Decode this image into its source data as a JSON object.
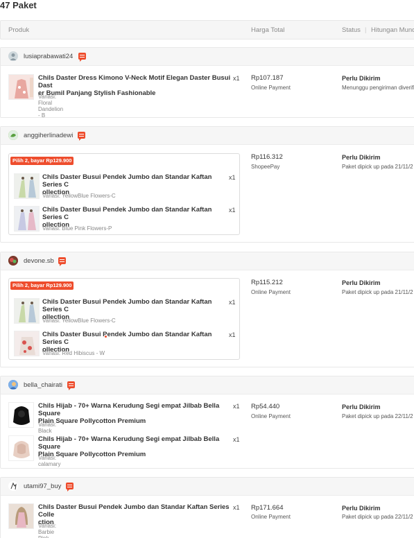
{
  "page_title": "47 Paket",
  "table_header": {
    "produk": "Produk",
    "harga_total": "Harga Total",
    "status": "Status",
    "separator": "|",
    "hitungan": "Hitungan Mundur"
  },
  "orders": [
    {
      "username": "lusiaprabawati24",
      "items": [
        {
          "name_line1": "Chils Daster Dress Kimono V-Neck Motif Elegan Daster Busui Dast",
          "name_line2": "er Bumil Panjang Stylish Fashionable",
          "qty": "x1",
          "variant": "Variasi: Floral Dandelion - B"
        }
      ],
      "price": "Rp107.187",
      "payment": "Online Payment",
      "status": "Perlu Dikirim",
      "status_desc": "Menunggu pengiriman diverifi"
    },
    {
      "username": "anggiherlinadewi",
      "promo": "Pilih 2, bayar Rp129.900",
      "items": [
        {
          "name_line1": "Chils Daster Busui Pendek Jumbo dan Standar Kaftan Series C",
          "name_line2": "ollection",
          "qty": "x1",
          "variant": "Variasi: YellowBlue Flowers-C"
        },
        {
          "name_line1": "Chils Daster Busui Pendek Jumbo dan Standar Kaftan Series C",
          "name_line2": "ollection",
          "qty": "x1",
          "variant": "Variasi: Blue Pink Flowers-P"
        }
      ],
      "price": "Rp116.312",
      "payment": "ShopeePay",
      "status": "Perlu Dikirim",
      "status_desc": "Paket dipick up pada 21/11/2"
    },
    {
      "username": "devone.sb",
      "promo": "Pilih 2, bayar Rp129.900",
      "items": [
        {
          "name_line1": "Chils Daster Busui Pendek Jumbo dan Standar Kaftan Series C",
          "name_line2": "ollection",
          "qty": "x1",
          "variant": "Variasi: YellowBlue Flowers-C"
        },
        {
          "name_line1": "Chils Daster Busui Pendek Jumbo dan Standar Kaftan Series C",
          "name_line2": "ollection",
          "qty": "x1",
          "variant": "Variasi: Red Hibiscus - W"
        }
      ],
      "price": "Rp115.212",
      "payment": "Online Payment",
      "status": "Perlu Dikirim",
      "status_desc": "Paket dipick up pada 21/11/2"
    },
    {
      "username": "bella_chairati",
      "items": [
        {
          "name_line1": "Chils Hijab - 70+ Warna Kerudung Segi empat Jilbab Bella Square",
          "name_line2": "Plain Square Pollycotton Premium",
          "qty": "x1",
          "variant": "Variasi: Black"
        },
        {
          "name_line1": "Chils Hijab - 70+ Warna Kerudung Segi empat Jilbab Bella Square",
          "name_line2": "Plain Square Pollycotton Premium",
          "qty": "x1",
          "variant": "Variasi: calamary"
        }
      ],
      "price": "Rp54.440",
      "payment": "Online Payment",
      "status": "Perlu Dikirim",
      "status_desc": "Paket dipick up pada 22/11/2"
    },
    {
      "username": "utami97_buy",
      "items": [
        {
          "name_line1": "Chils Daster Busui Pendek Jumbo dan Standar Kaftan Series Colle",
          "name_line2": "ction",
          "qty": "x1",
          "variant": "Variasi: Barbie Pink - VB"
        }
      ],
      "price": "Rp171.664",
      "payment": "Online Payment",
      "status": "Perlu Dikirim",
      "status_desc": "Paket dipick up pada 22/11/2"
    }
  ],
  "colors": {
    "accent": "#ee4d2d",
    "header_bg": "#f6f6f6",
    "border": "#e8e8e8"
  }
}
